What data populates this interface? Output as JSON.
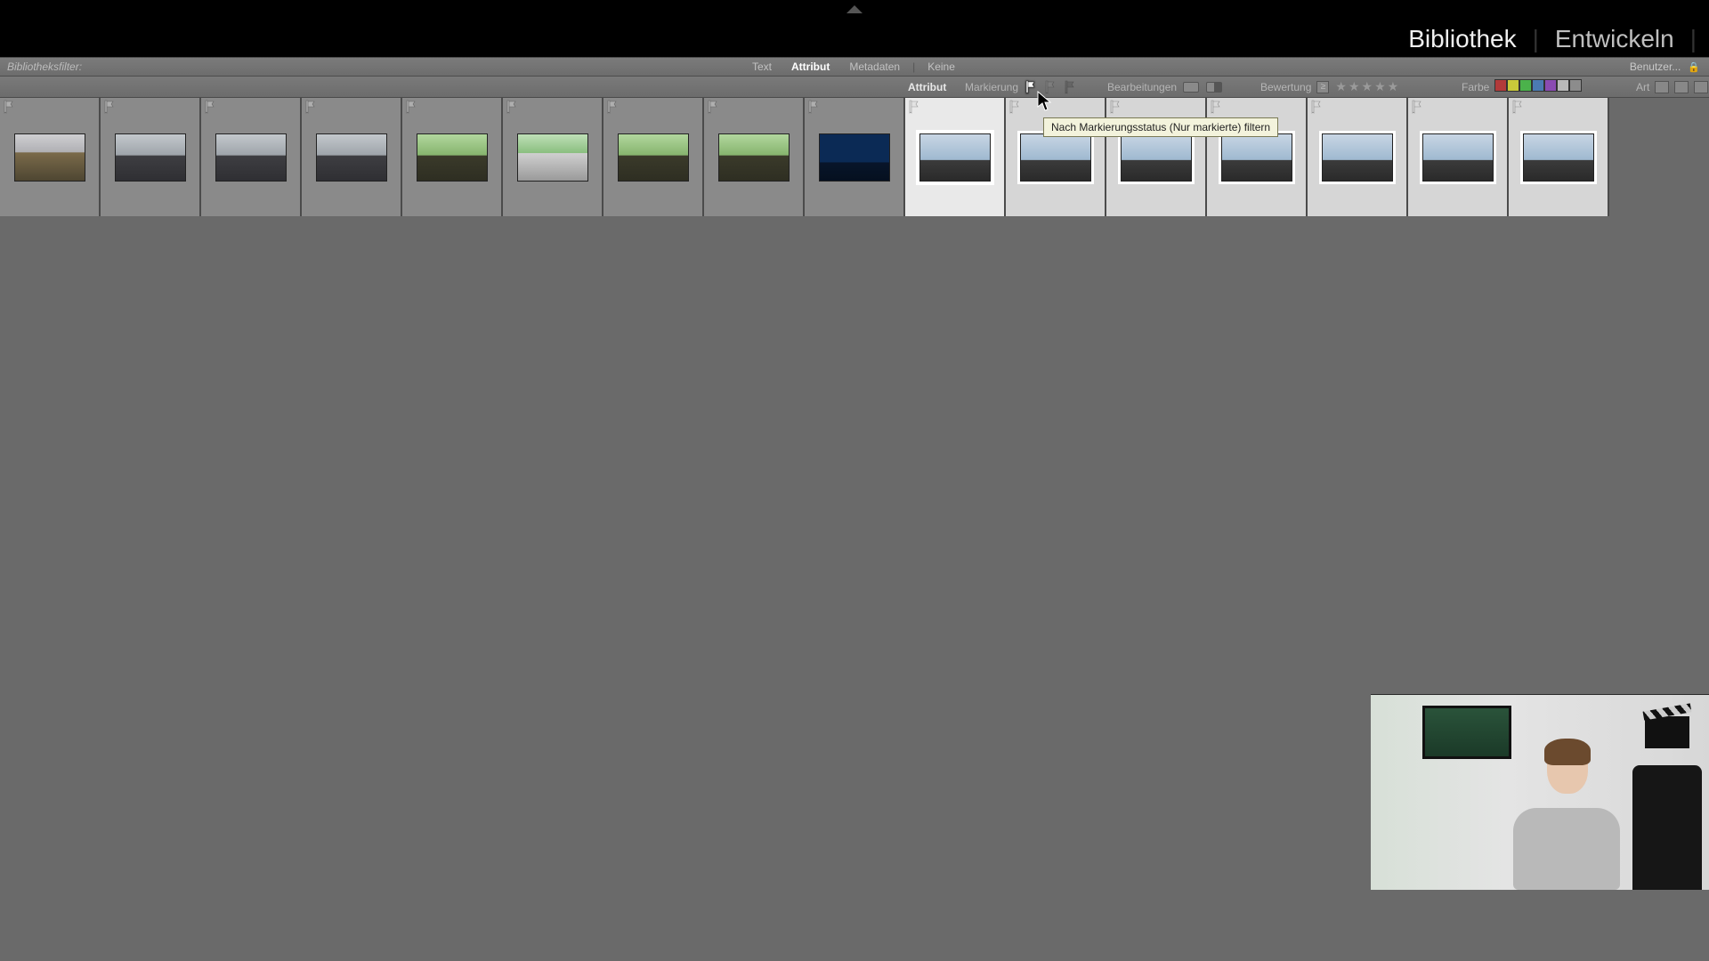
{
  "modules": {
    "library": "Bibliothek",
    "develop": "Entwickeln",
    "active": "library"
  },
  "filterbar": {
    "label": "Bibliotheksfilter:",
    "tabs": {
      "text": "Text",
      "attribute": "Attribut",
      "metadata": "Metadaten",
      "none": "Keine"
    },
    "active_tab": "attribute",
    "preset": "Benutzer..."
  },
  "attrbar": {
    "attribute": "Attribut",
    "flag": "Markierung",
    "edits": "Bearbeitungen",
    "rating": "Bewertung",
    "color": "Farbe",
    "kind": "Art",
    "rating_operator": "≥",
    "star_count": 5,
    "color_swatches": [
      "#b23a3a",
      "#c9c93a",
      "#4bb24b",
      "#4b7ab2",
      "#8a4bb2",
      "#b9b9b9",
      "#8c8c8c"
    ],
    "flag_states": [
      "picked",
      "unflagged",
      "rejected"
    ],
    "flag_hovered": "picked"
  },
  "tooltip": "Nach Markierungsstatus (Nur markierte) filtern",
  "thumbnails": [
    {
      "flag": "unflagged",
      "group": "dark",
      "style": "moor"
    },
    {
      "flag": "unflagged",
      "group": "dark",
      "style": "hiker"
    },
    {
      "flag": "unflagged",
      "group": "dark",
      "style": "hiker"
    },
    {
      "flag": "unflagged",
      "group": "dark",
      "style": "hiker"
    },
    {
      "flag": "unflagged",
      "group": "dark",
      "style": "cow"
    },
    {
      "flag": "unflagged",
      "group": "dark",
      "style": "path"
    },
    {
      "flag": "unflagged",
      "group": "dark",
      "style": "cow"
    },
    {
      "flag": "unflagged",
      "group": "dark",
      "style": "cow"
    },
    {
      "flag": "unflagged",
      "group": "dark",
      "style": "bluebk"
    },
    {
      "flag": "unflagged",
      "group": "light",
      "style": "sky",
      "selected": true
    },
    {
      "flag": "unflagged",
      "group": "light",
      "style": "sky"
    },
    {
      "flag": "unflagged",
      "group": "light",
      "style": "sky"
    },
    {
      "flag": "unflagged",
      "group": "light",
      "style": "sky"
    },
    {
      "flag": "unflagged",
      "group": "light",
      "style": "sky"
    },
    {
      "flag": "unflagged",
      "group": "light",
      "style": "sky"
    },
    {
      "flag": "unflagged",
      "group": "light",
      "style": "sky"
    }
  ]
}
